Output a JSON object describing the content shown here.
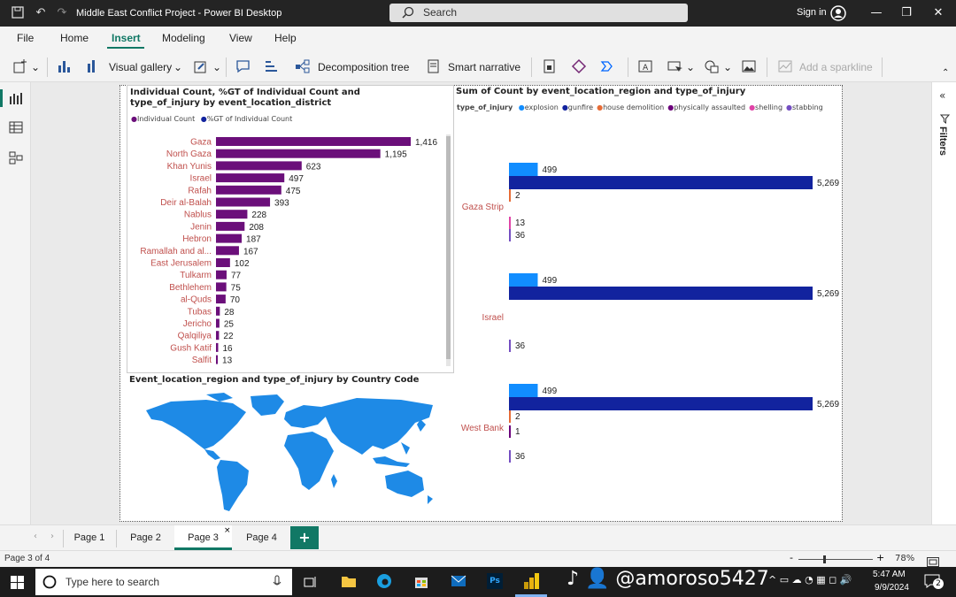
{
  "window": {
    "title": "Middle East Conflict Project - Power BI Desktop",
    "search_placeholder": "Search",
    "signin": "Sign in"
  },
  "menu": [
    "File",
    "Home",
    "Insert",
    "Modeling",
    "View",
    "Help"
  ],
  "ribbon": {
    "visual_gallery": "Visual gallery",
    "decomposition_tree": "Decomposition tree",
    "smart_narrative": "Smart narrative",
    "add_sparkline": "Add a sparkline"
  },
  "filters_label": "Filters",
  "visual1": {
    "title": "Individual Count, %GT of Individual Count and type_of_injury by event_location_district",
    "legend": [
      "Individual Count",
      "%GT of Individual Count"
    ],
    "bar_color": "#6b0f7a"
  },
  "visual2": {
    "title": "Sum of Count by event_location_region and type_of_injury",
    "legend_title": "type_of_injury",
    "legend": [
      {
        "name": "explosion",
        "color": "#118dff"
      },
      {
        "name": "gunfire",
        "color": "#12239e"
      },
      {
        "name": "house demolition",
        "color": "#e66c37"
      },
      {
        "name": "physically assaulted",
        "color": "#6b007b"
      },
      {
        "name": "shelling",
        "color": "#e044a7"
      },
      {
        "name": "stabbing",
        "color": "#744ec2"
      }
    ]
  },
  "visual3": {
    "title": "Event_location_region and type_of_injury by Country Code",
    "map_color": "#1e8ae6"
  },
  "chart_data": [
    {
      "type": "bar",
      "title": "Individual Count, %GT of Individual Count and type_of_injury by event_location_district",
      "categories": [
        "Gaza",
        "North Gaza",
        "Khan Yunis",
        "Israel",
        "Rafah",
        "Deir al-Balah",
        "Nablus",
        "Jenin",
        "Hebron",
        "Ramallah and al...",
        "East Jerusalem",
        "Tulkarm",
        "Bethlehem",
        "al-Quds",
        "Tubas",
        "Jericho",
        "Qalqiliya",
        "Gush Katif",
        "Salfit"
      ],
      "values": [
        1416,
        1195,
        623,
        497,
        475,
        393,
        228,
        208,
        187,
        167,
        102,
        77,
        75,
        70,
        28,
        25,
        22,
        16,
        13
      ],
      "value_labels": [
        "1,416",
        "1,195",
        "623",
        "497",
        "475",
        "393",
        "228",
        "208",
        "187",
        "167",
        "102",
        "77",
        "75",
        "70",
        "28",
        "25",
        "22",
        "16",
        "13"
      ],
      "series": [
        {
          "name": "Individual Count"
        },
        {
          "name": "%GT of Individual Count"
        }
      ]
    },
    {
      "type": "bar",
      "title": "Sum of Count by event_location_region and type_of_injury",
      "categories": [
        "Gaza Strip",
        "Israel",
        "West Bank"
      ],
      "series": [
        {
          "name": "explosion",
          "values": [
            499,
            499,
            499
          ]
        },
        {
          "name": "gunfire",
          "values": [
            5269,
            5269,
            5269
          ]
        },
        {
          "name": "house demolition",
          "values": [
            2,
            null,
            2
          ]
        },
        {
          "name": "physically assaulted",
          "values": [
            null,
            null,
            1
          ]
        },
        {
          "name": "shelling",
          "values": [
            13,
            null,
            null
          ]
        },
        {
          "name": "stabbing",
          "values": [
            36,
            36,
            36
          ]
        }
      ],
      "value_labels": {
        "Gaza Strip": [
          "499",
          "5,269",
          "2",
          "",
          "13",
          "36"
        ],
        "Israel": [
          "499",
          "5,269",
          "",
          "",
          "",
          "36"
        ],
        "West Bank": [
          "499",
          "5,269",
          "2",
          "1",
          "",
          "36"
        ]
      }
    }
  ],
  "tabs": [
    "Page 1",
    "Page 2",
    "Page 3",
    "Page 4"
  ],
  "active_tab": "Page 3",
  "status": {
    "page": "Page 3 of 4",
    "zoom": "78%"
  },
  "taskbar": {
    "search": "Type here to search",
    "time": "5:47 AM",
    "date": "9/9/2024",
    "overlay": "@amoroso5427",
    "notifications": "2"
  }
}
